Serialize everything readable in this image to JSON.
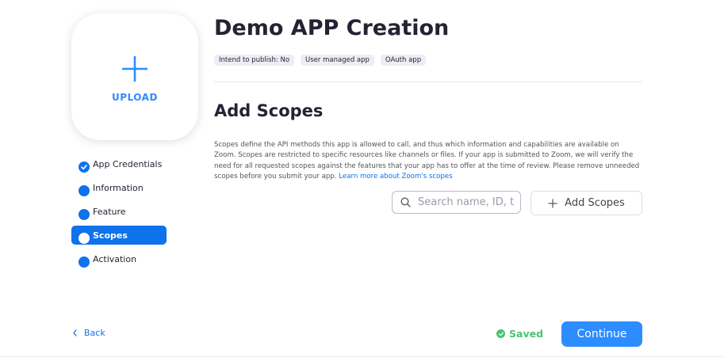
{
  "upload": {
    "label": "UPLOAD",
    "icon": "plus-icon"
  },
  "steps": [
    {
      "label": "App Credentials",
      "icon": "check-circle-icon",
      "state": "completed"
    },
    {
      "label": "Information",
      "icon": "dot-icon",
      "state": "pending"
    },
    {
      "label": "Feature",
      "icon": "dot-icon",
      "state": "pending"
    },
    {
      "label": "Scopes",
      "icon": "dot-icon",
      "state": "active"
    },
    {
      "label": "Activation",
      "icon": "dot-icon",
      "state": "pending"
    }
  ],
  "header": {
    "title": "Demo APP Creation",
    "tags": [
      "Intend to publish: No",
      "User managed app",
      "OAuth app"
    ]
  },
  "section": {
    "title": "Add Scopes",
    "description": "Scopes define the API methods this app is allowed to call, and thus which information and capabilities are available on Zoom. Scopes are restricted to specific resources like channels or files. If your app is submitted to Zoom, we will verify the need for all requested scopes against the features that your app has to offer at the time of review. Please remove unneeded scopes before you submit your app.",
    "link_text": "Learn more about Zoom's scopes"
  },
  "search": {
    "placeholder": "Search name, ID, t",
    "value": "",
    "icon": "search-icon"
  },
  "add_scopes": {
    "label": "Add Scopes",
    "icon": "plus-icon"
  },
  "footer": {
    "back_label": "Back",
    "saved_label": "Saved",
    "continue_label": "Continue"
  },
  "colors": {
    "accent": "#0E72ED",
    "primary_button": "#2D8CFF",
    "success": "#47C46E",
    "text": "#232333"
  }
}
